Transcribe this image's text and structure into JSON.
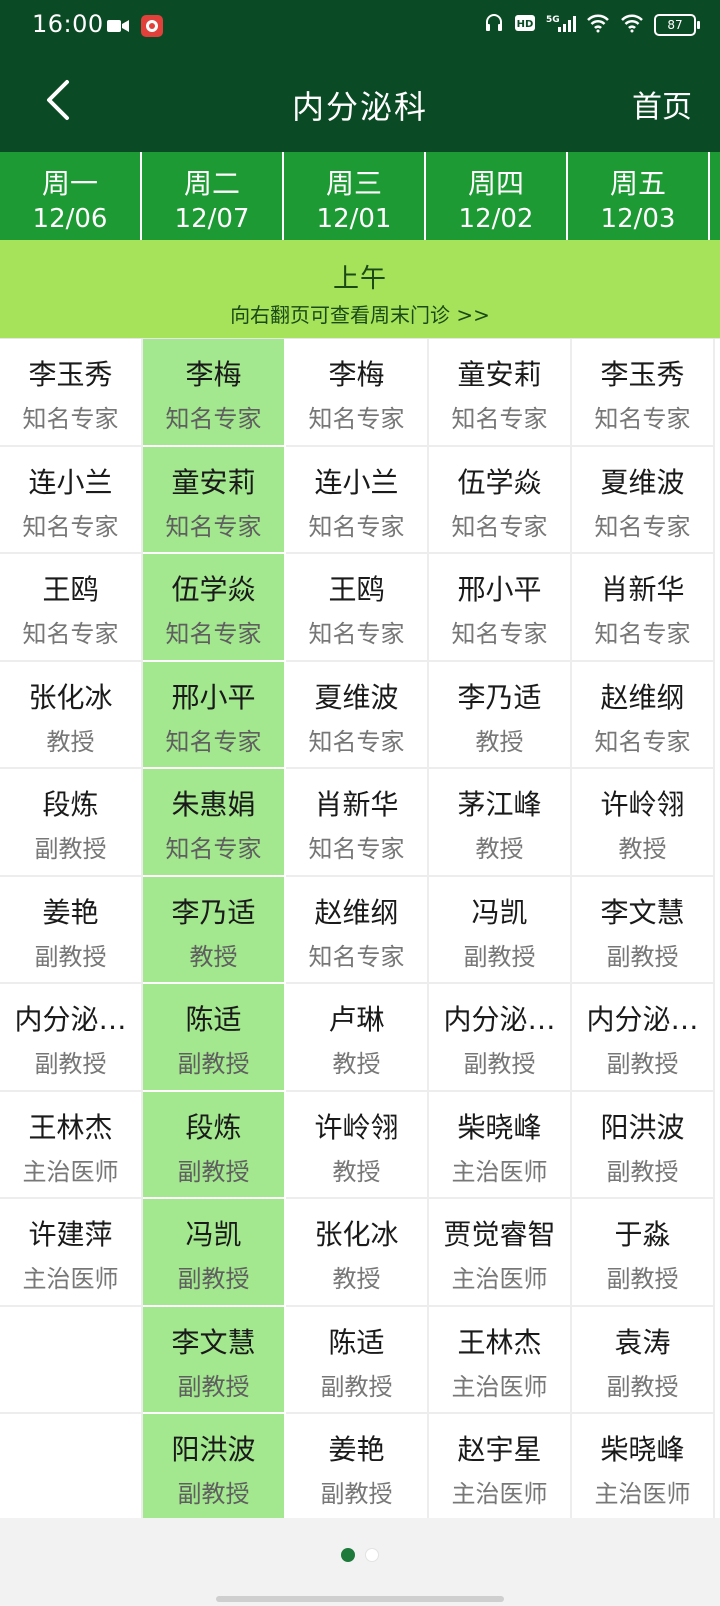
{
  "status_bar": {
    "time": "16:00",
    "battery": "87",
    "icons": [
      "camera-icon",
      "app-icon",
      "headset-icon",
      "hd-icon",
      "5g-signal-icon",
      "wifi-icon",
      "battery-icon"
    ]
  },
  "nav": {
    "title": "内分泌科",
    "home": "首页",
    "back_icon": "chevron-left-icon"
  },
  "colors": {
    "nav_bg": "#0a4a24",
    "day_bg": "#1e9a34",
    "banner_bg": "#a6e35a",
    "selected_col_bg": "#a3e88f"
  },
  "days": [
    {
      "name": "周一",
      "date": "12/06"
    },
    {
      "name": "周二",
      "date": "12/07"
    },
    {
      "name": "周三",
      "date": "12/01"
    },
    {
      "name": "周四",
      "date": "12/02"
    },
    {
      "name": "周五",
      "date": "12/03"
    }
  ],
  "selected_day_index": 1,
  "session": {
    "title": "上午",
    "hint": "向右翻页可查看周末门诊 >>"
  },
  "schedule": [
    [
      {
        "name": "李玉秀",
        "title": "知名专家"
      },
      {
        "name": "连小兰",
        "title": "知名专家"
      },
      {
        "name": "王鸥",
        "title": "知名专家"
      },
      {
        "name": "张化冰",
        "title": "教授"
      },
      {
        "name": "段炼",
        "title": "副教授"
      },
      {
        "name": "姜艳",
        "title": "副教授"
      },
      {
        "name": "内分泌…",
        "title": "副教授"
      },
      {
        "name": "王林杰",
        "title": "主治医师"
      },
      {
        "name": "许建萍",
        "title": "主治医师"
      },
      {
        "name": "",
        "title": ""
      },
      {
        "name": "",
        "title": ""
      }
    ],
    [
      {
        "name": "李梅",
        "title": "知名专家"
      },
      {
        "name": "童安莉",
        "title": "知名专家"
      },
      {
        "name": "伍学焱",
        "title": "知名专家"
      },
      {
        "name": "邢小平",
        "title": "知名专家"
      },
      {
        "name": "朱惠娟",
        "title": "知名专家"
      },
      {
        "name": "李乃适",
        "title": "教授"
      },
      {
        "name": "陈适",
        "title": "副教授"
      },
      {
        "name": "段炼",
        "title": "副教授"
      },
      {
        "name": "冯凯",
        "title": "副教授"
      },
      {
        "name": "李文慧",
        "title": "副教授"
      },
      {
        "name": "阳洪波",
        "title": "副教授"
      }
    ],
    [
      {
        "name": "李梅",
        "title": "知名专家"
      },
      {
        "name": "连小兰",
        "title": "知名专家"
      },
      {
        "name": "王鸥",
        "title": "知名专家"
      },
      {
        "name": "夏维波",
        "title": "知名专家"
      },
      {
        "name": "肖新华",
        "title": "知名专家"
      },
      {
        "name": "赵维纲",
        "title": "知名专家"
      },
      {
        "name": "卢琳",
        "title": "教授"
      },
      {
        "name": "许岭翎",
        "title": "教授"
      },
      {
        "name": "张化冰",
        "title": "教授"
      },
      {
        "name": "陈适",
        "title": "副教授"
      },
      {
        "name": "姜艳",
        "title": "副教授"
      }
    ],
    [
      {
        "name": "童安莉",
        "title": "知名专家"
      },
      {
        "name": "伍学焱",
        "title": "知名专家"
      },
      {
        "name": "邢小平",
        "title": "知名专家"
      },
      {
        "name": "李乃适",
        "title": "教授"
      },
      {
        "name": "茅江峰",
        "title": "教授"
      },
      {
        "name": "冯凯",
        "title": "副教授"
      },
      {
        "name": "内分泌…",
        "title": "副教授"
      },
      {
        "name": "柴晓峰",
        "title": "主治医师"
      },
      {
        "name": "贾觉睿智",
        "title": "主治医师"
      },
      {
        "name": "王林杰",
        "title": "主治医师"
      },
      {
        "name": "赵宇星",
        "title": "主治医师"
      }
    ],
    [
      {
        "name": "李玉秀",
        "title": "知名专家"
      },
      {
        "name": "夏维波",
        "title": "知名专家"
      },
      {
        "name": "肖新华",
        "title": "知名专家"
      },
      {
        "name": "赵维纲",
        "title": "知名专家"
      },
      {
        "name": "许岭翎",
        "title": "教授"
      },
      {
        "name": "李文慧",
        "title": "副教授"
      },
      {
        "name": "内分泌…",
        "title": "副教授"
      },
      {
        "name": "阳洪波",
        "title": "副教授"
      },
      {
        "name": "于淼",
        "title": "副教授"
      },
      {
        "name": "袁涛",
        "title": "副教授"
      },
      {
        "name": "柴晓峰",
        "title": "主治医师"
      }
    ]
  ],
  "pager": {
    "pages": 2,
    "current": 0
  }
}
